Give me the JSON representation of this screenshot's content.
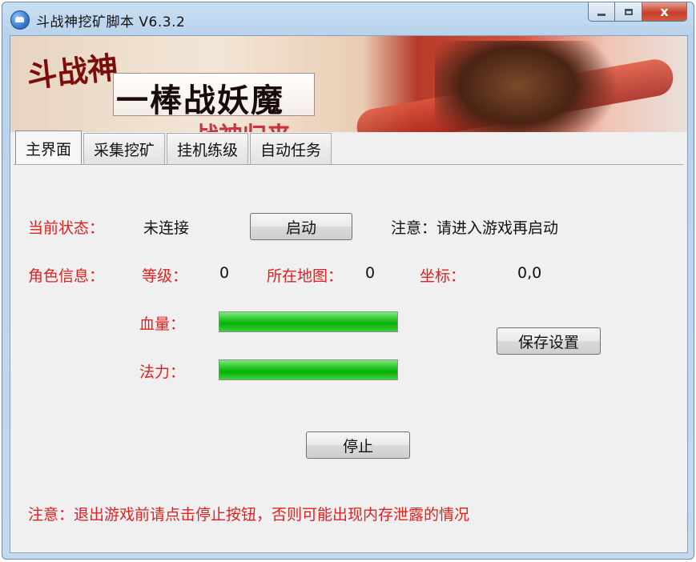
{
  "window": {
    "title": "斗战神挖矿脚本 V6.3.2",
    "close_glyph": "x"
  },
  "banner": {
    "logo_text": "斗战神",
    "slogan": "一棒战妖魔",
    "sub_text": "战神归来"
  },
  "tabs": [
    {
      "label": "主界面",
      "active": true
    },
    {
      "label": "采集挖矿",
      "active": false
    },
    {
      "label": "挂机练级",
      "active": false
    },
    {
      "label": "自动任务",
      "active": false
    }
  ],
  "main": {
    "status_label": "当前状态：",
    "status_value": "未连接",
    "start_button": "启动",
    "start_note": "注意：请进入游戏再启动",
    "role_label": "角色信息：",
    "level_label": "等级：",
    "level_value": "0",
    "map_label": "所在地图：",
    "map_value": "0",
    "coord_label": "坐标：",
    "coord_value": "0,0",
    "hp_label": "血量：",
    "hp_fraction": 1.0,
    "mp_label": "法力：",
    "mp_fraction": 1.0,
    "save_button": "保存设置",
    "stop_button": "停止",
    "footer_note": "注意：退出游戏前请点击停止按钮，否则可能出现内存泄露的情况"
  },
  "colors": {
    "warning_red": "#e12020",
    "progress_green": "#10b810"
  }
}
